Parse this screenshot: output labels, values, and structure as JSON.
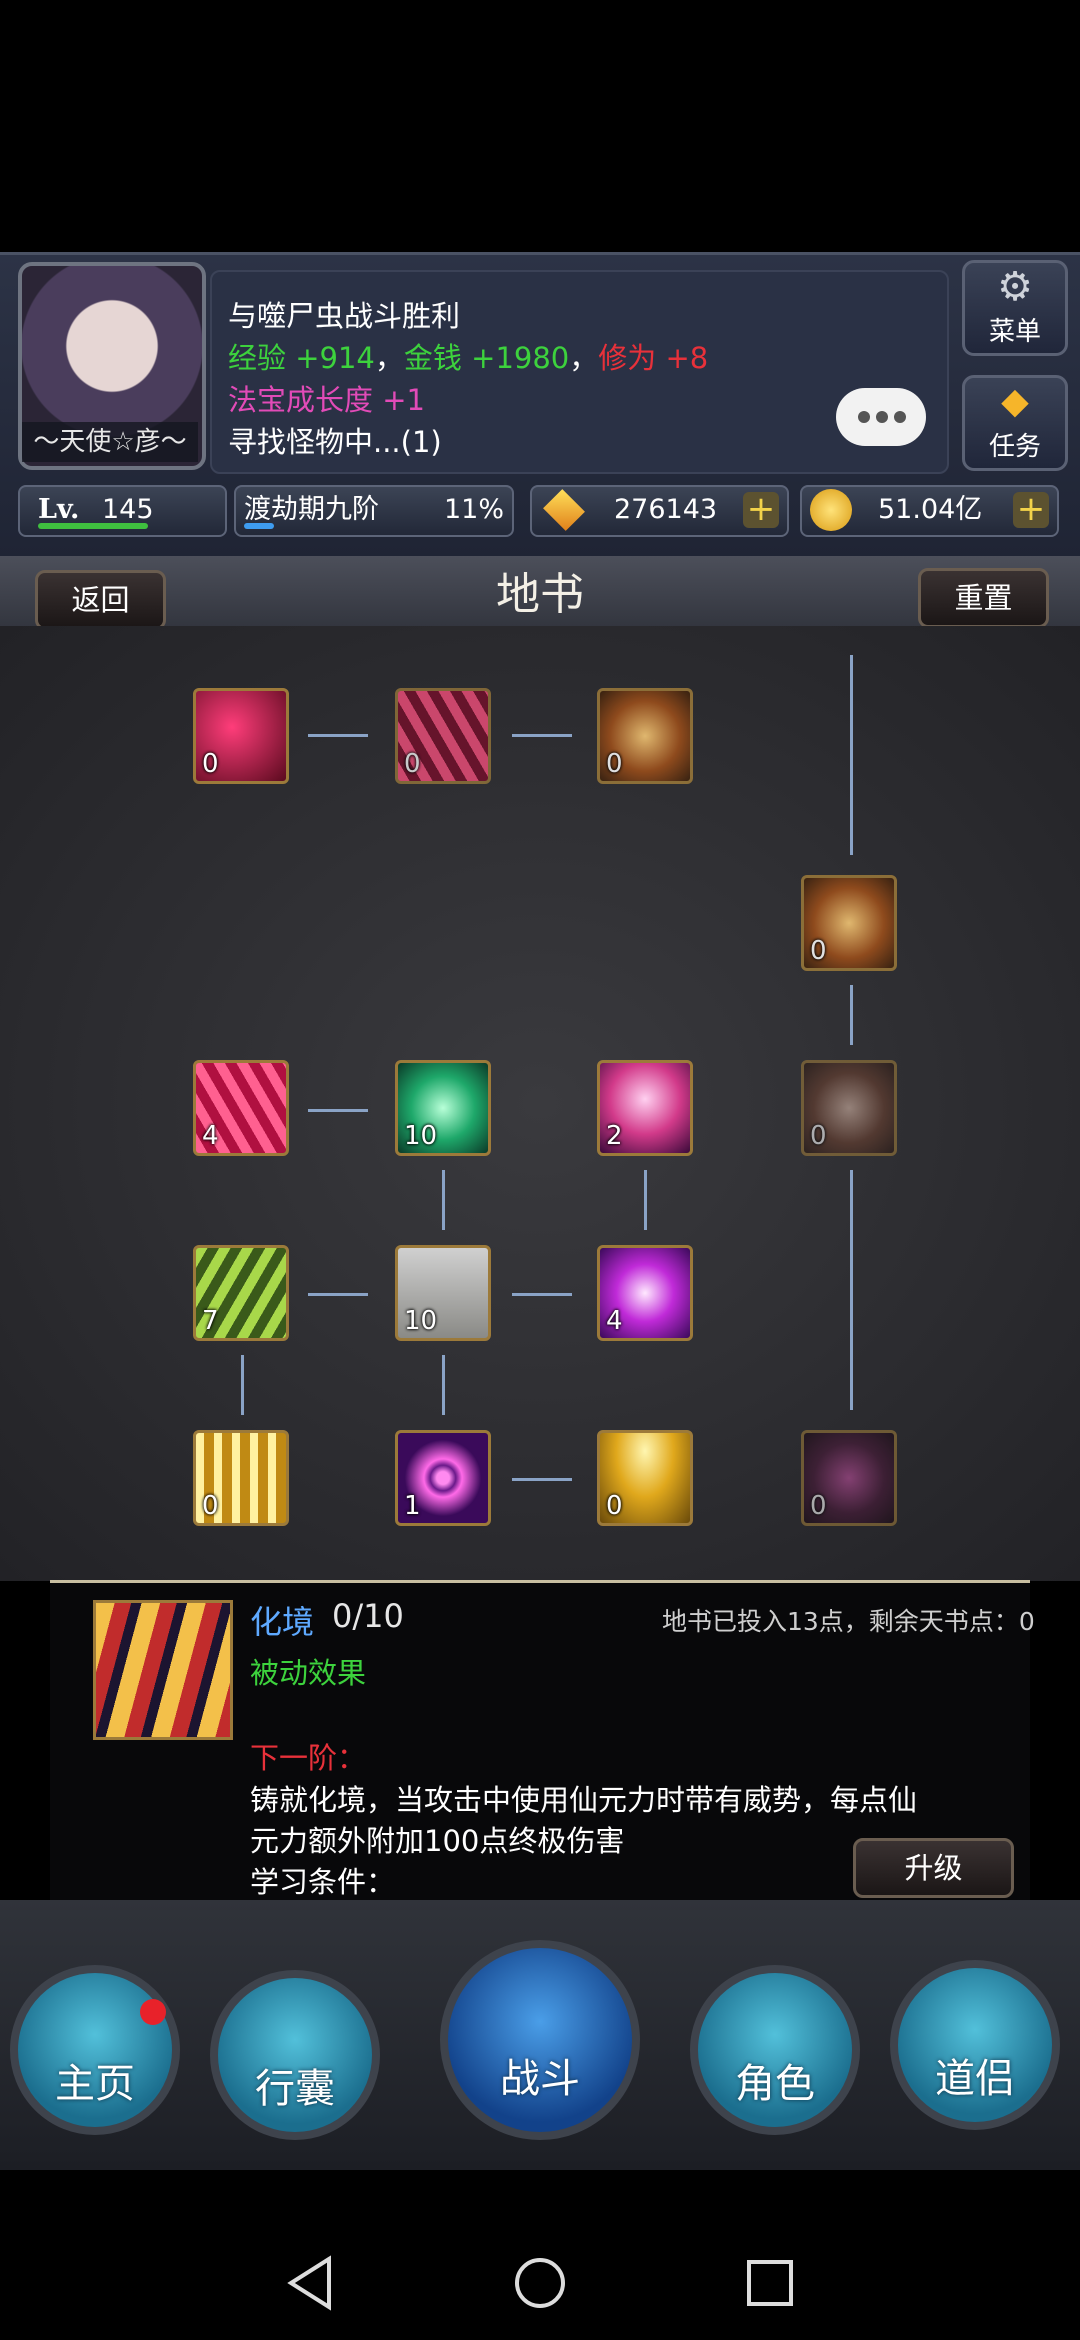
{
  "player": {
    "name": "～天使☆彦～",
    "level_label": "Lv.",
    "level": "145",
    "realm": "渡劫期九阶",
    "realm_progress": "11%"
  },
  "battle_log": {
    "line1": "与噬尸虫战斗胜利",
    "exp_label": "经验",
    "exp_value": "+914",
    "sep": "，",
    "money_label": "金钱",
    "money_value": "+1980",
    "cult_label": "修为",
    "cult_value": "+8",
    "line3_label": "法宝成长度",
    "line3_value": "+1",
    "line4": "寻找怪物中...(1)"
  },
  "currency": {
    "gems": "276143",
    "gold": "51.04亿",
    "plus": "+"
  },
  "side_buttons": {
    "menu": "菜单",
    "task": "任务"
  },
  "header": {
    "title": "地书",
    "back": "返回",
    "reset": "重置"
  },
  "skills": {
    "r1c1": "0",
    "r1c2": "0",
    "r1c3": "0",
    "r2c4": "0",
    "r3c1": "4",
    "r3c2": "10",
    "r3c3": "2",
    "r3c4": "0",
    "r4c1": "7",
    "r4c2": "10",
    "r4c3": "4",
    "r5c1": "0",
    "r5c2": "1",
    "r5c3": "0",
    "r5c4": "0"
  },
  "detail": {
    "name": "化境",
    "level": "0/10",
    "points": "地书已投入13点，剩余天书点：0",
    "type": "被动效果",
    "next_label": "下一阶：",
    "desc1": "铸就化境，当攻击中使用仙元力时带有威势，每点仙",
    "desc2": "元力额外附加100点终极伤害",
    "req": "学习条件：",
    "upgrade": "升级"
  },
  "nav": {
    "home": "主页",
    "bag": "行囊",
    "battle": "战斗",
    "role": "角色",
    "partner": "道侣"
  },
  "colors": {
    "green": "#3dd23d",
    "red": "#e8313a",
    "blue_name": "#5ea9ff"
  }
}
